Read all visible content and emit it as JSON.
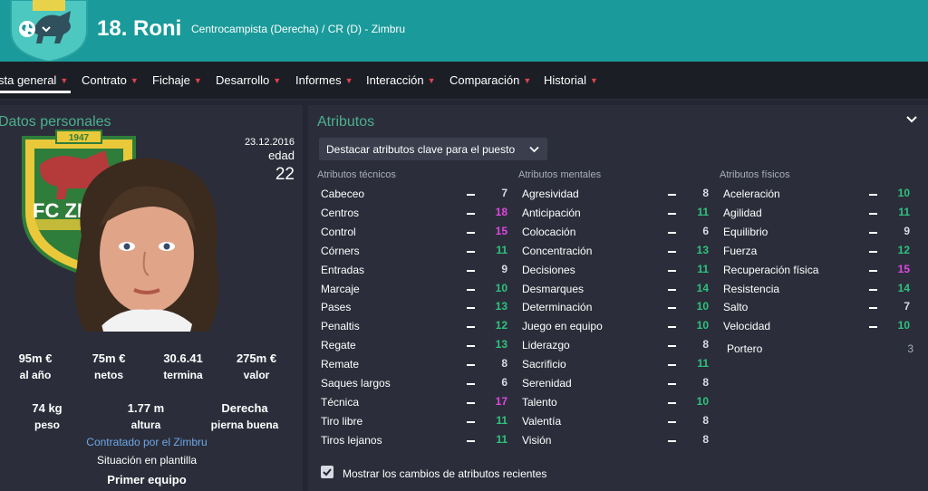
{
  "header": {
    "number_name": "18. Roni",
    "subtitle": "Centrocampista (Derecha) / CR (D) - Zimbru",
    "crest_year": "1947"
  },
  "nav": {
    "items": [
      {
        "label": "sta general",
        "left": 0
      },
      {
        "label": "Contrato"
      },
      {
        "label": "Fichaje"
      },
      {
        "label": "Desarrollo"
      },
      {
        "label": "Informes"
      },
      {
        "label": "Interacción"
      },
      {
        "label": "Comparación"
      },
      {
        "label": "Historial"
      }
    ]
  },
  "personal": {
    "title": "Datos personales",
    "crest_year": "1947",
    "crest_text": "FC ZIM",
    "date": "23.12.2016",
    "age_label": "edad",
    "age_value": "22",
    "wage_value": "95m €",
    "wage_label": "al año",
    "net_value": "75m €",
    "net_label": "netos",
    "expiry_value": "30.6.41",
    "expiry_label": "termina",
    "value_value": "275m €",
    "value_label": "valor",
    "weight_value": "74 kg",
    "weight_label": "peso",
    "height_value": "1.77 m",
    "height_label": "altura",
    "foot_value": "Derecha",
    "foot_label": "pierna buena",
    "contract_link": "Contratado por el Zimbru",
    "squad_label": "Situación en plantilla",
    "squad_value": "Primer equipo"
  },
  "attributes": {
    "title": "Atributos",
    "dropdown": "Destacar atributos clave para el puesto",
    "technical_header": "Atributos técnicos",
    "mental_header": "Atributos mentales",
    "physical_header": "Atributos físicos",
    "technical": [
      {
        "name": "Cabeceo",
        "value": "7"
      },
      {
        "name": "Centros",
        "value": "18"
      },
      {
        "name": "Control",
        "value": "15"
      },
      {
        "name": "Córners",
        "value": "11"
      },
      {
        "name": "Entradas",
        "value": "9"
      },
      {
        "name": "Marcaje",
        "value": "10"
      },
      {
        "name": "Pases",
        "value": "13"
      },
      {
        "name": "Penaltis",
        "value": "12"
      },
      {
        "name": "Regate",
        "value": "13"
      },
      {
        "name": "Remate",
        "value": "8"
      },
      {
        "name": "Saques largos",
        "value": "6"
      },
      {
        "name": "Técnica",
        "value": "17"
      },
      {
        "name": "Tiro libre",
        "value": "11"
      },
      {
        "name": "Tiros lejanos",
        "value": "11"
      }
    ],
    "mental": [
      {
        "name": "Agresividad",
        "value": "8"
      },
      {
        "name": "Anticipación",
        "value": "11"
      },
      {
        "name": "Colocación",
        "value": "6"
      },
      {
        "name": "Concentración",
        "value": "13"
      },
      {
        "name": "Decisiones",
        "value": "11"
      },
      {
        "name": "Desmarques",
        "value": "14"
      },
      {
        "name": "Determinación",
        "value": "10"
      },
      {
        "name": "Juego en equipo",
        "value": "10"
      },
      {
        "name": "Liderazgo",
        "value": "8"
      },
      {
        "name": "Sacrificio",
        "value": "11"
      },
      {
        "name": "Serenidad",
        "value": "8"
      },
      {
        "name": "Talento",
        "value": "10"
      },
      {
        "name": "Valentía",
        "value": "8"
      },
      {
        "name": "Visión",
        "value": "8"
      }
    ],
    "physical": [
      {
        "name": "Aceleración",
        "value": "10"
      },
      {
        "name": "Agilidad",
        "value": "11"
      },
      {
        "name": "Equilibrio",
        "value": "9"
      },
      {
        "name": "Fuerza",
        "value": "12"
      },
      {
        "name": "Recuperación física",
        "value": "15"
      },
      {
        "name": "Resistencia",
        "value": "14"
      },
      {
        "name": "Salto",
        "value": "7"
      },
      {
        "name": "Velocidad",
        "value": "10"
      }
    ],
    "goalkeeper_label": "Portero",
    "goalkeeper_value": "3",
    "checkbox_label": "Mostrar los cambios de atributos recientes"
  },
  "colors": {
    "header_teal": "#1a9a9a",
    "low": "#d8dbe3",
    "mid": "#2ec27e",
    "high": "#e047e0"
  }
}
